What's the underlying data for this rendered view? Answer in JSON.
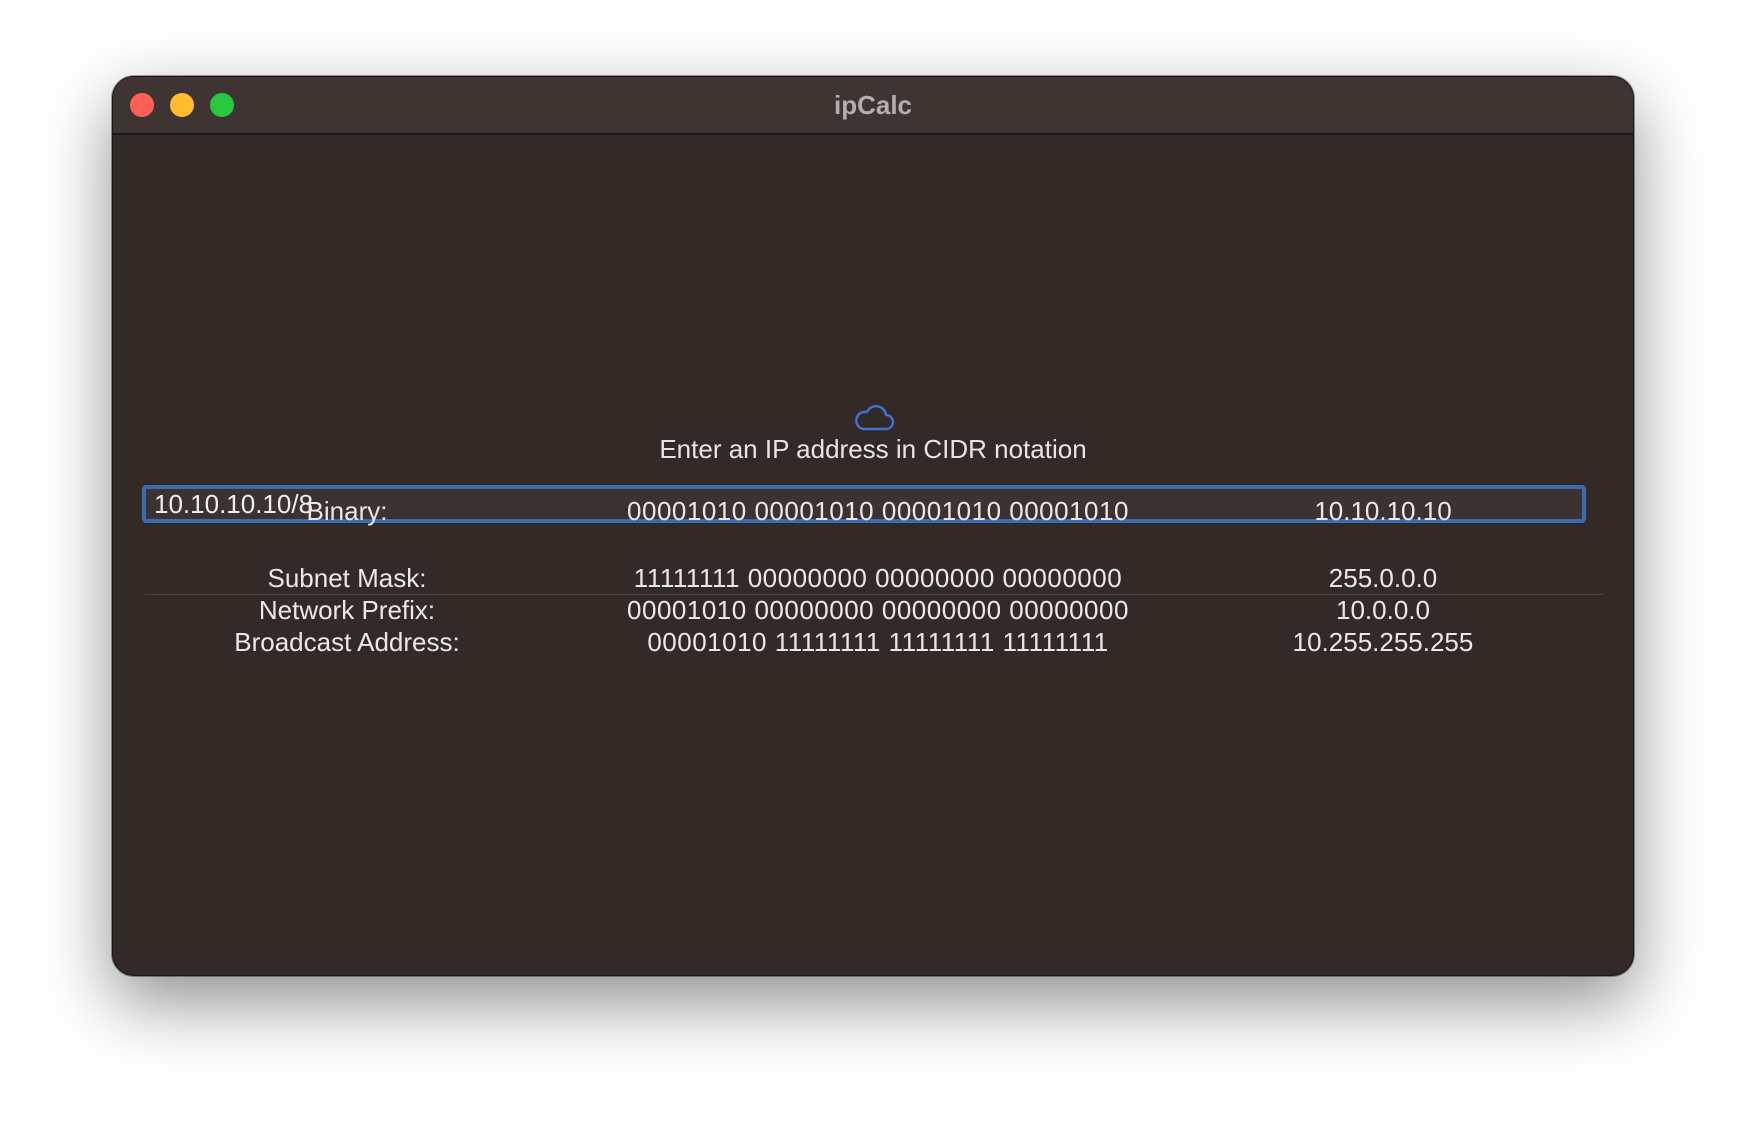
{
  "window": {
    "title": "ipCalc"
  },
  "icon": "cloud-icon",
  "prompt": "Enter an IP address in CIDR notation",
  "input": {
    "value": "10.10.10.10/8"
  },
  "binary_row": {
    "label": "Binary:",
    "binary": "00001010 00001010 00001010 00001010",
    "decimal": "10.10.10.10"
  },
  "results": [
    {
      "label": "Subnet Mask:",
      "binary": "11111111 00000000 00000000 00000000",
      "decimal": "255.0.0.0"
    },
    {
      "label": "Network Prefix:",
      "binary": "00001010 00000000 00000000 00000000",
      "decimal": "10.0.0.0"
    },
    {
      "label": "Broadcast Address:",
      "binary": "00001010 11111111 11111111 11111111",
      "decimal": "10.255.255.255"
    }
  ],
  "colors": {
    "accent": "#3e6bb0",
    "window_bg": "#332a28",
    "titlebar_bg": "#3e3533",
    "close": "#fe5f57",
    "minimize": "#febc2e",
    "zoom": "#28c840"
  }
}
